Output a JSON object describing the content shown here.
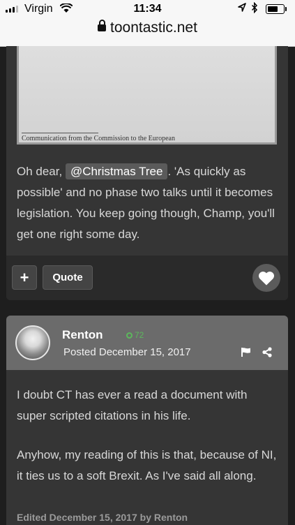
{
  "status_bar": {
    "carrier": "Virgin",
    "time": "11:34",
    "battery_level": 0.72
  },
  "browser": {
    "url": "toontastic.net"
  },
  "post1": {
    "image_caption": "Communication from the Commission to the European",
    "text_before_mention": "Oh dear, ",
    "mention": "@Christmas Tree",
    "text_after_mention": ". 'As quickly as possible' and no phase two talks until it becomes legislation. You keep going though, Champ, you'll get one right some day.",
    "plus_label": "+",
    "quote_label": "Quote"
  },
  "post2": {
    "author": "Renton",
    "reputation": "72",
    "posted": "Posted December 15, 2017",
    "paragraph1": "I doubt CT has ever a read a document with super scripted citations in his life.",
    "paragraph2": "Anyhow, my reading of this is that, because of NI, it ties us to a soft Brexit. As I've said all along.",
    "edited": "Edited December 15, 2017 by Renton"
  },
  "colors": {
    "page_bg": "#1e1e1e",
    "card_bg": "#353535",
    "header_bg": "#6b6b6b",
    "reputation_green": "#5cb85c"
  },
  "icons": [
    "signal-icon",
    "wifi-icon",
    "location-arrow-icon",
    "bluetooth-icon",
    "battery-icon",
    "lock-icon",
    "heart-icon",
    "flag-icon",
    "share-icon"
  ]
}
